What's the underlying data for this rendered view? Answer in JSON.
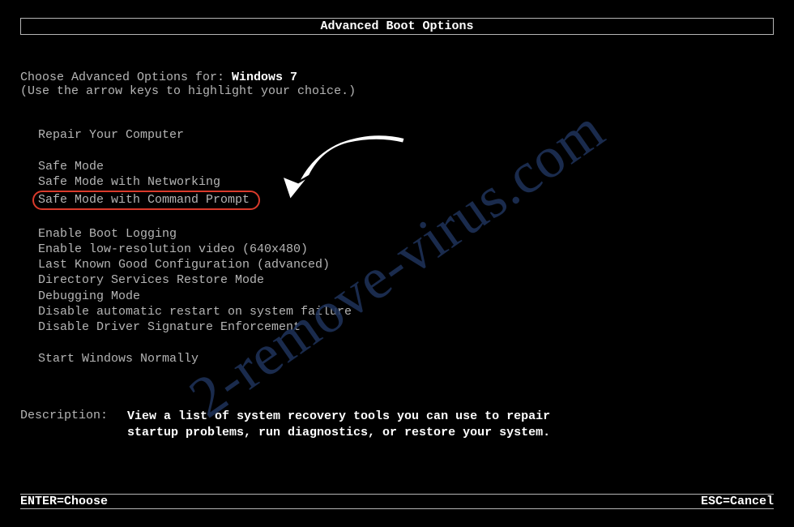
{
  "title": "Advanced Boot Options",
  "instructions": {
    "line1_prefix": "Choose Advanced Options for: ",
    "os_name": "Windows 7",
    "line2": "(Use the arrow keys to highlight your choice.)"
  },
  "options": {
    "group1": [
      "Repair Your Computer"
    ],
    "group2": [
      "Safe Mode",
      "Safe Mode with Networking",
      "Safe Mode with Command Prompt"
    ],
    "group3": [
      "Enable Boot Logging",
      "Enable low-resolution video (640x480)",
      "Last Known Good Configuration (advanced)",
      "Directory Services Restore Mode",
      "Debugging Mode",
      "Disable automatic restart on system failure",
      "Disable Driver Signature Enforcement"
    ],
    "group4": [
      "Start Windows Normally"
    ]
  },
  "highlighted_option": "Safe Mode with Command Prompt",
  "description": {
    "label": "Description:",
    "text": "View a list of system recovery tools you can use to repair startup problems, run diagnostics, or restore your system."
  },
  "footer": {
    "left": "ENTER=Choose",
    "right": "ESC=Cancel"
  },
  "watermark": "2-remove-virus.com"
}
